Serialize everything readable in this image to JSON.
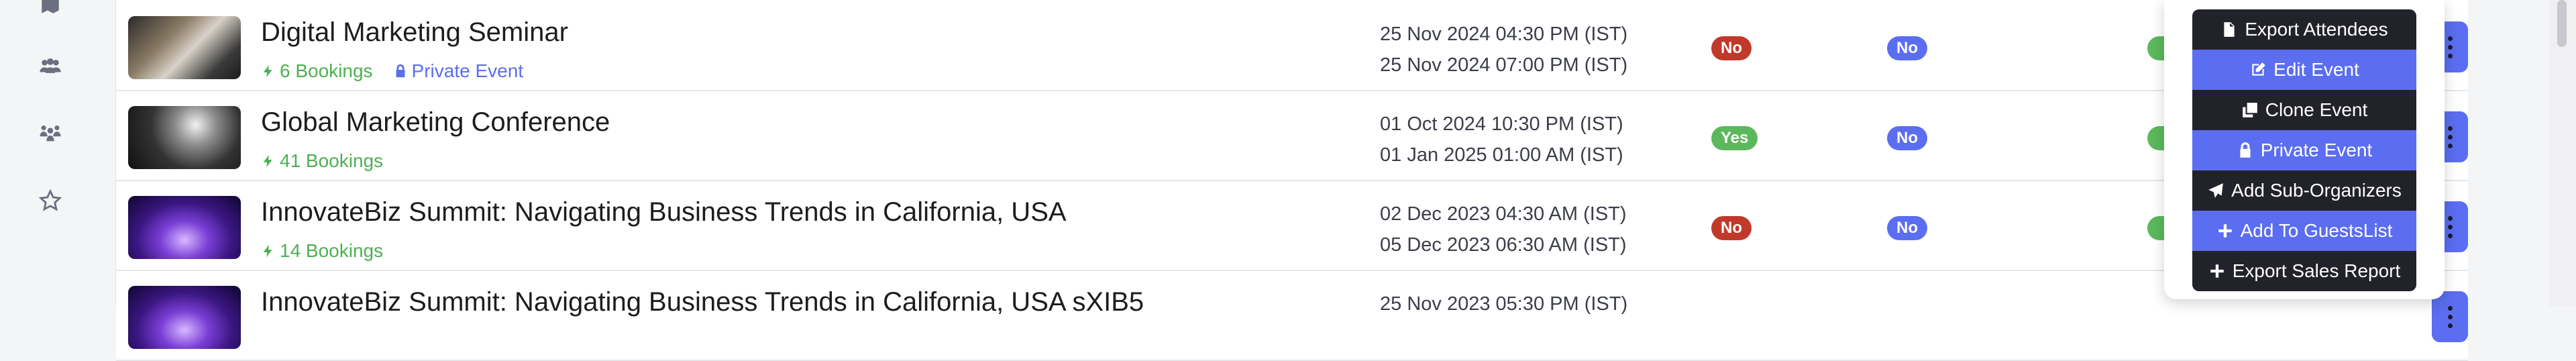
{
  "sidebar": {
    "icons": [
      "map-icon",
      "users-group-icon",
      "user-network-icon",
      "star-icon"
    ]
  },
  "events": [
    {
      "title": "Digital Marketing Seminar",
      "bookings": "6 Bookings",
      "private_label": "Private Event",
      "start": "25 Nov 2024 04:30 PM (IST)",
      "end": "25 Nov 2024 07:00 PM (IST)",
      "status1": "No",
      "status2": "No"
    },
    {
      "title": "Global Marketing Conference",
      "bookings": "41 Bookings",
      "private_label": "",
      "start": "01 Oct 2024 10:30 PM (IST)",
      "end": "01 Jan 2025 01:00 AM (IST)",
      "status1": "Yes",
      "status2": "No"
    },
    {
      "title": "InnovateBiz Summit: Navigating Business Trends in California, USA",
      "bookings": "14 Bookings",
      "private_label": "",
      "start": "02 Dec 2023 04:30 AM (IST)",
      "end": "05 Dec 2023 06:30 AM (IST)",
      "status1": "No",
      "status2": "No"
    },
    {
      "title": "InnovateBiz Summit: Navigating Business Trends in California, USA sXIB5",
      "bookings": "",
      "private_label": "",
      "start": "25 Nov 2023 05:30 PM (IST)",
      "end": "",
      "status1": "",
      "status2": ""
    }
  ],
  "menu": {
    "items": [
      {
        "label": "Export Attendees",
        "icon": "file-export-icon"
      },
      {
        "label": "Edit Event",
        "icon": "edit-icon"
      },
      {
        "label": "Clone Event",
        "icon": "clone-icon"
      },
      {
        "label": "Private Event",
        "icon": "lock-icon"
      },
      {
        "label": "Add Sub-Organizers",
        "icon": "paper-plane-icon"
      },
      {
        "label": "Add To GuestsList",
        "icon": "plus-icon"
      },
      {
        "label": "Export Sales Report",
        "icon": "plus-icon"
      }
    ]
  },
  "colors": {
    "accent": "#5b6df0",
    "success": "#5cb85c",
    "danger": "#c0392b",
    "menu_dark": "#22232a"
  }
}
